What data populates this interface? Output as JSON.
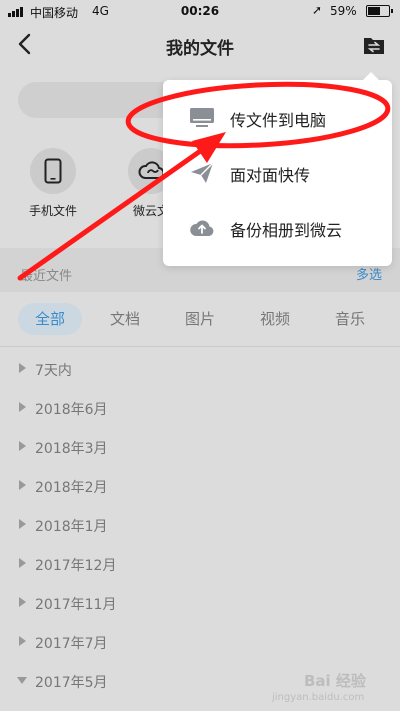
{
  "status_bar": {
    "carrier": "中国移动",
    "network": "4G",
    "time": "00:26",
    "battery": "59%",
    "battery_level": 0.59
  },
  "nav": {
    "title": "我的文件"
  },
  "quick_entries": [
    {
      "label": "手机文件",
      "icon": "phone-icon"
    },
    {
      "label": "微云文",
      "icon": "weiyun-cloud-icon"
    }
  ],
  "recent": {
    "title": "最近文件",
    "multi_select": "多选"
  },
  "tabs": [
    {
      "label": "全部",
      "active": true
    },
    {
      "label": "文档",
      "active": false
    },
    {
      "label": "图片",
      "active": false
    },
    {
      "label": "视频",
      "active": false
    },
    {
      "label": "音乐",
      "active": false
    }
  ],
  "groups": [
    {
      "label": "7天内",
      "expanded": false
    },
    {
      "label": "2018年6月",
      "expanded": false
    },
    {
      "label": "2018年3月",
      "expanded": false
    },
    {
      "label": "2018年2月",
      "expanded": false
    },
    {
      "label": "2018年1月",
      "expanded": false
    },
    {
      "label": "2017年12月",
      "expanded": false
    },
    {
      "label": "2017年11月",
      "expanded": false
    },
    {
      "label": "2017年7月",
      "expanded": false
    },
    {
      "label": "2017年5月",
      "expanded": true
    }
  ],
  "menu": {
    "items": [
      {
        "label": "传文件到电脑",
        "icon": "monitor-icon"
      },
      {
        "label": "面对面快传",
        "icon": "paper-plane-icon"
      },
      {
        "label": "备份相册到微云",
        "icon": "cloud-upload-icon"
      }
    ]
  },
  "watermark": {
    "brand": "Bai 经验",
    "url": "jingyan.baidu.com"
  },
  "colors": {
    "accent": "#3a8cc9",
    "annotation": "#ff1a1a",
    "dim_background": "#dcdcdc"
  }
}
